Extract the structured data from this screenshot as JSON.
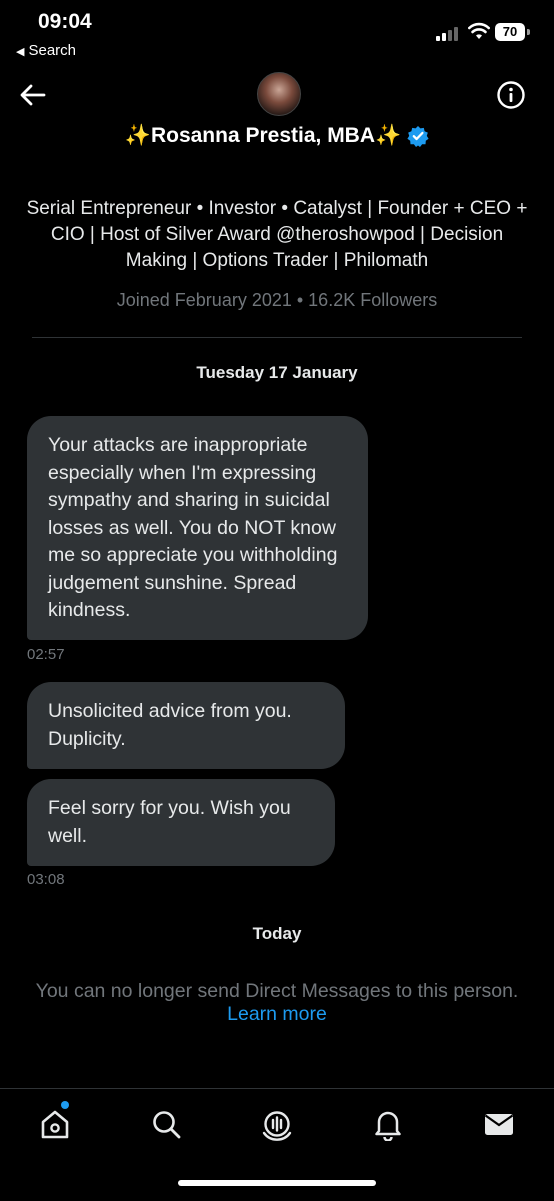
{
  "status_bar": {
    "time": "09:04",
    "back_label": "Search",
    "battery": "70"
  },
  "header": {
    "name": "✨Rosanna Prestia, MBA✨"
  },
  "profile": {
    "bio": "Serial Entrepreneur • Investor • Catalyst | Founder + CEO + CIO | Host of Silver Award @theroshowpod | Decision Making | Options Trader | Philomath",
    "joined": "Joined February 2021 • 16.2K Followers"
  },
  "conversation": {
    "day1": "Tuesday 17 January",
    "messages": [
      {
        "text": "Your attacks are inappropriate especially when I'm expressing sympathy and sharing in suicidal losses as well. You do NOT know me so appreciate you withholding judgement sunshine. Spread kindness.",
        "time": "02:57"
      },
      {
        "text": "Unsolicited advice from you. Duplicity.",
        "time": ""
      },
      {
        "text": "Feel sorry for you. Wish you well.",
        "time": "03:08"
      }
    ],
    "day2": "Today",
    "notice": "You can no longer send Direct Messages to this person.",
    "learn_more": "Learn more"
  },
  "tabbar": {
    "items": [
      "home-icon",
      "search-icon",
      "spaces-icon",
      "notifications-icon",
      "messages-icon"
    ]
  },
  "colors": {
    "accent": "#1d9bf0",
    "bubble": "#2f3336",
    "muted": "#71767b"
  }
}
